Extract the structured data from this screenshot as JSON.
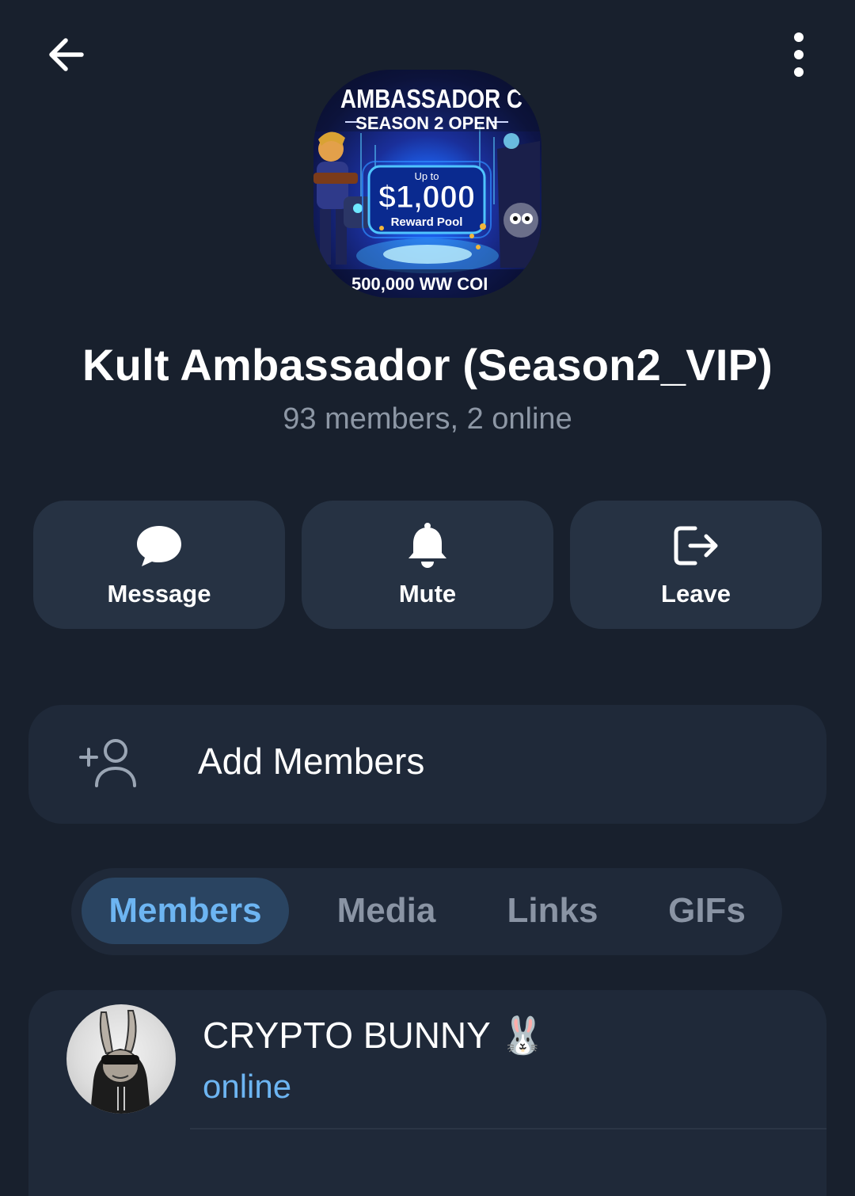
{
  "header": {
    "back_icon": "arrow-left-icon",
    "menu_icon": "more-vertical-icon"
  },
  "group": {
    "avatar_text": {
      "title_line": "AMBASSADOR C",
      "season_line": "SEASON 2 OPEN",
      "up_to": "Up to",
      "amount": "$1,000",
      "pool": "Reward Pool",
      "coins": "500,000 WW COI"
    },
    "name": "Kult Ambassador (Season2_VIP)",
    "status": "93 members, 2 online"
  },
  "actions": [
    {
      "label": "Message",
      "icon": "chat-bubble-icon"
    },
    {
      "label": "Mute",
      "icon": "bell-icon"
    },
    {
      "label": "Leave",
      "icon": "logout-icon"
    }
  ],
  "add_members": {
    "label": "Add Members",
    "icon": "add-user-icon"
  },
  "tabs": [
    {
      "label": "Members",
      "active": true
    },
    {
      "label": "Media",
      "active": false
    },
    {
      "label": "Links",
      "active": false
    },
    {
      "label": "GIFs",
      "active": false
    }
  ],
  "members": [
    {
      "name": "CRYPTO BUNNY 🐰",
      "status": "online"
    }
  ],
  "colors": {
    "background": "#18202d",
    "card": "#1f2939",
    "action_button": "#263243",
    "accent": "#6db5f2",
    "muted_text": "#8d97a5"
  }
}
